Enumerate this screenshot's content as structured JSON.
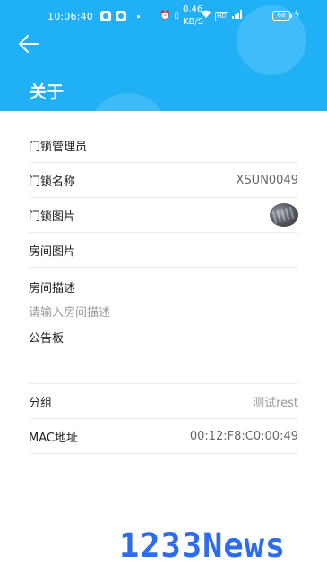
{
  "statusbar": {
    "time": "10:06:40",
    "speed_top": "0.46",
    "speed_bottom": "KB/S",
    "hd": "HD",
    "battery": "68"
  },
  "header": {
    "title": "关于"
  },
  "rows": {
    "admin": {
      "label": "门锁管理员",
      "value": "."
    },
    "name": {
      "label": "门锁名称",
      "value": "XSUN0049"
    },
    "lock_image": {
      "label": "门锁图片"
    },
    "room_image": {
      "label": "房间图片"
    },
    "room_desc": {
      "label": "房间描述",
      "placeholder": "请输入房间描述"
    },
    "board": {
      "label": "公告板"
    },
    "group": {
      "label": "分组",
      "value": "测试rest"
    },
    "mac": {
      "label": "MAC地址",
      "value": "00:12:F8:C0:00:49"
    }
  },
  "watermark": "1233News",
  "colors": {
    "header_bg": "#1fb0f6",
    "watermark": "#2d6cf0"
  }
}
